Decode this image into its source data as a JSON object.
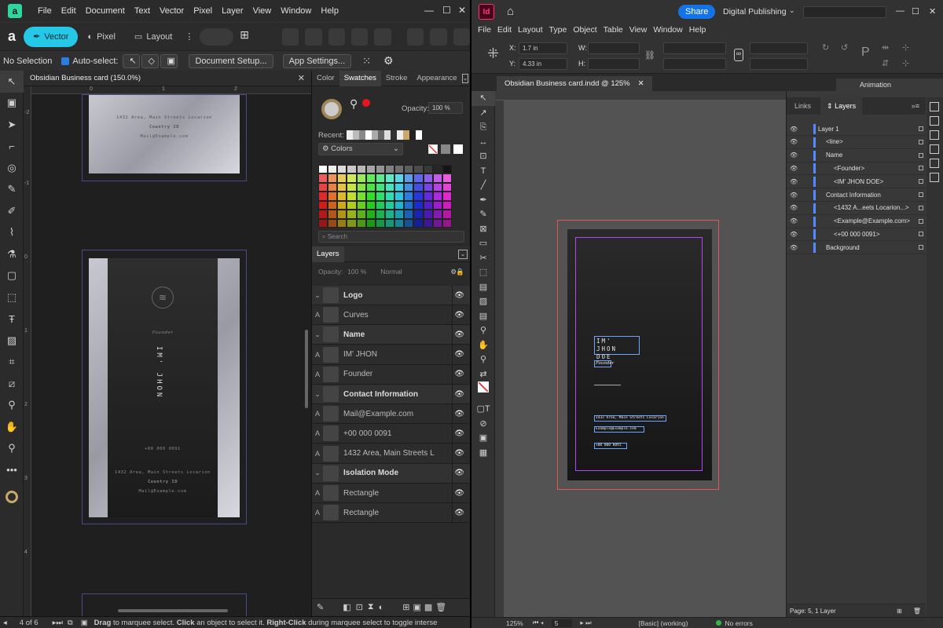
{
  "affinity": {
    "menu": [
      "File",
      "Edit",
      "Document",
      "Text",
      "Vector",
      "Pixel",
      "Layer",
      "View",
      "Window",
      "Help"
    ],
    "personas": [
      "Vector",
      "Pixel",
      "Layout"
    ],
    "context": {
      "selection": "No Selection",
      "auto_select": "Auto-select:",
      "doc_setup": "Document Setup...",
      "app_settings": "App Settings..."
    },
    "doc_tab": "Obsidian Business card (150.0%)",
    "ruler_top": [
      "0",
      "1",
      "2"
    ],
    "ruler_left": [
      "-2",
      "-1",
      "0",
      "1",
      "2",
      "3",
      "4"
    ],
    "card_back": {
      "address": "1432 Area, Main Streets Locarion",
      "country": "Country ID",
      "mail": "Mail@Example.com"
    },
    "card_front": {
      "title": "Founder",
      "name": "IM' JHON",
      "phone": "+00 000 0091",
      "address": "1432 Area, Main Streets Locarion",
      "country": "Country ID",
      "mail": "Mail@Example.com"
    },
    "panel_tabs": [
      "Color",
      "Swatches",
      "Stroke",
      "Appearance"
    ],
    "opacity_label": "Opacity:",
    "opacity_value": "100 %",
    "recent_label": "Recent:",
    "palette": "Colors",
    "search_placeholder": "Search",
    "layers_tab": "Layers",
    "layers_opacity_label": "Opacity:",
    "layers_opacity": "100 %",
    "blend": "Normal",
    "layers": [
      {
        "name": "Logo",
        "child": false
      },
      {
        "name": "Curves",
        "child": true
      },
      {
        "name": "Name",
        "child": false
      },
      {
        "name": "IM' JHON",
        "child": true
      },
      {
        "name": "Founder",
        "child": true
      },
      {
        "name": "Contact Information",
        "child": false
      },
      {
        "name": "Mail@Example.com",
        "child": true
      },
      {
        "name": "+00 000 0091",
        "child": true
      },
      {
        "name": "1432 Area, Main Streets L",
        "child": true
      },
      {
        "name": "Isolation Mode",
        "child": false
      },
      {
        "name": "Rectangle",
        "child": true
      },
      {
        "name": "Rectangle",
        "child": true
      }
    ],
    "status": {
      "page": "4 of 6",
      "drag": "Drag",
      "drag_text": " to marquee select. ",
      "click": "Click",
      "click_text": " an object to select it. ",
      "rclick": "Right-Click",
      "rclick_text": " during marquee select to toggle interse"
    }
  },
  "indesign": {
    "menu": [
      "File",
      "Edit",
      "Layout",
      "Type",
      "Object",
      "Table",
      "View",
      "Window",
      "Help"
    ],
    "share": "Share",
    "workspace": "Digital Publishing",
    "x_label": "X:",
    "x_value": "1.7 in",
    "y_label": "Y:",
    "y_value": "4.33 in",
    "w_label": "W:",
    "h_label": "H:",
    "doc_tab": "Obsidian Business card.indd @ 125%",
    "animation_tab": "Animation",
    "panel_tabs": [
      "Links",
      "Layers"
    ],
    "card": {
      "name_line1": "IM'",
      "name_line2": "JHON  DOE",
      "founder": "Founder",
      "address": "1432 Area, Main Streets Locarion",
      "mail": "Example@Example.com",
      "phone": "+00 000 0091"
    },
    "layers": [
      {
        "name": "Layer 1",
        "indent": 1
      },
      {
        "name": "<line>",
        "indent": 2
      },
      {
        "name": "Name",
        "indent": 2
      },
      {
        "name": "<Founder>",
        "indent": 3
      },
      {
        "name": "<IM' JHON  DOE>",
        "indent": 3
      },
      {
        "name": "Contact Information",
        "indent": 2
      },
      {
        "name": "<1432 A...eets Locarion...>",
        "indent": 3
      },
      {
        "name": "<Example@Example.com>",
        "indent": 3
      },
      {
        "name": "<+00 000 0091>",
        "indent": 3
      },
      {
        "name": "Background",
        "indent": 2
      }
    ],
    "layers_footer": "Page: 5, 1 Layer",
    "status": {
      "zoom": "125%",
      "page": "5",
      "style": "[Basic] (working)",
      "errors": "No errors"
    }
  }
}
